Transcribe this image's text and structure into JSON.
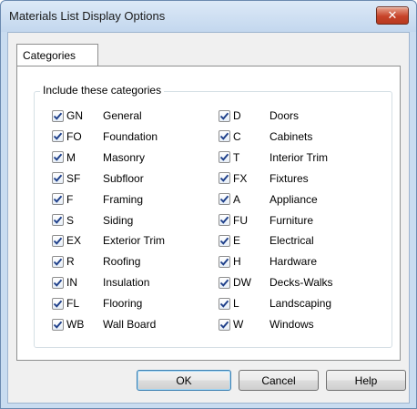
{
  "window": {
    "title": "Materials List Display Options",
    "close_label": "✕"
  },
  "tabs": [
    {
      "label": "Categories"
    }
  ],
  "group": {
    "label": "Include these categories",
    "left_column": [
      {
        "code": "GN",
        "name": "General",
        "checked": true
      },
      {
        "code": "FO",
        "name": "Foundation",
        "checked": true
      },
      {
        "code": "M",
        "name": "Masonry",
        "checked": true
      },
      {
        "code": "SF",
        "name": "Subfloor",
        "checked": true
      },
      {
        "code": "F",
        "name": "Framing",
        "checked": true
      },
      {
        "code": "S",
        "name": "Siding",
        "checked": true
      },
      {
        "code": "EX",
        "name": "Exterior Trim",
        "checked": true
      },
      {
        "code": "R",
        "name": "Roofing",
        "checked": true
      },
      {
        "code": "IN",
        "name": "Insulation",
        "checked": true
      },
      {
        "code": "FL",
        "name": "Flooring",
        "checked": true
      },
      {
        "code": "WB",
        "name": "Wall Board",
        "checked": true
      }
    ],
    "right_column": [
      {
        "code": "D",
        "name": "Doors",
        "checked": true
      },
      {
        "code": "C",
        "name": "Cabinets",
        "checked": true
      },
      {
        "code": "T",
        "name": "Interior Trim",
        "checked": true
      },
      {
        "code": "FX",
        "name": "Fixtures",
        "checked": true
      },
      {
        "code": "A",
        "name": "Appliance",
        "checked": true
      },
      {
        "code": "FU",
        "name": "Furniture",
        "checked": true
      },
      {
        "code": "E",
        "name": "Electrical",
        "checked": true
      },
      {
        "code": "H",
        "name": "Hardware",
        "checked": true
      },
      {
        "code": "DW",
        "name": "Decks-Walks",
        "checked": true
      },
      {
        "code": "L",
        "name": "Landscaping",
        "checked": true
      },
      {
        "code": "W",
        "name": "Windows",
        "checked": true
      }
    ]
  },
  "buttons": {
    "ok": "OK",
    "cancel": "Cancel",
    "help": "Help"
  },
  "icons": {
    "checkbox": "checkmark-icon",
    "close": "close-icon"
  },
  "colors": {
    "checkmark": "#1e3f8a",
    "close_button": "#c7432a",
    "default_button_border": "#3c7fb1"
  }
}
